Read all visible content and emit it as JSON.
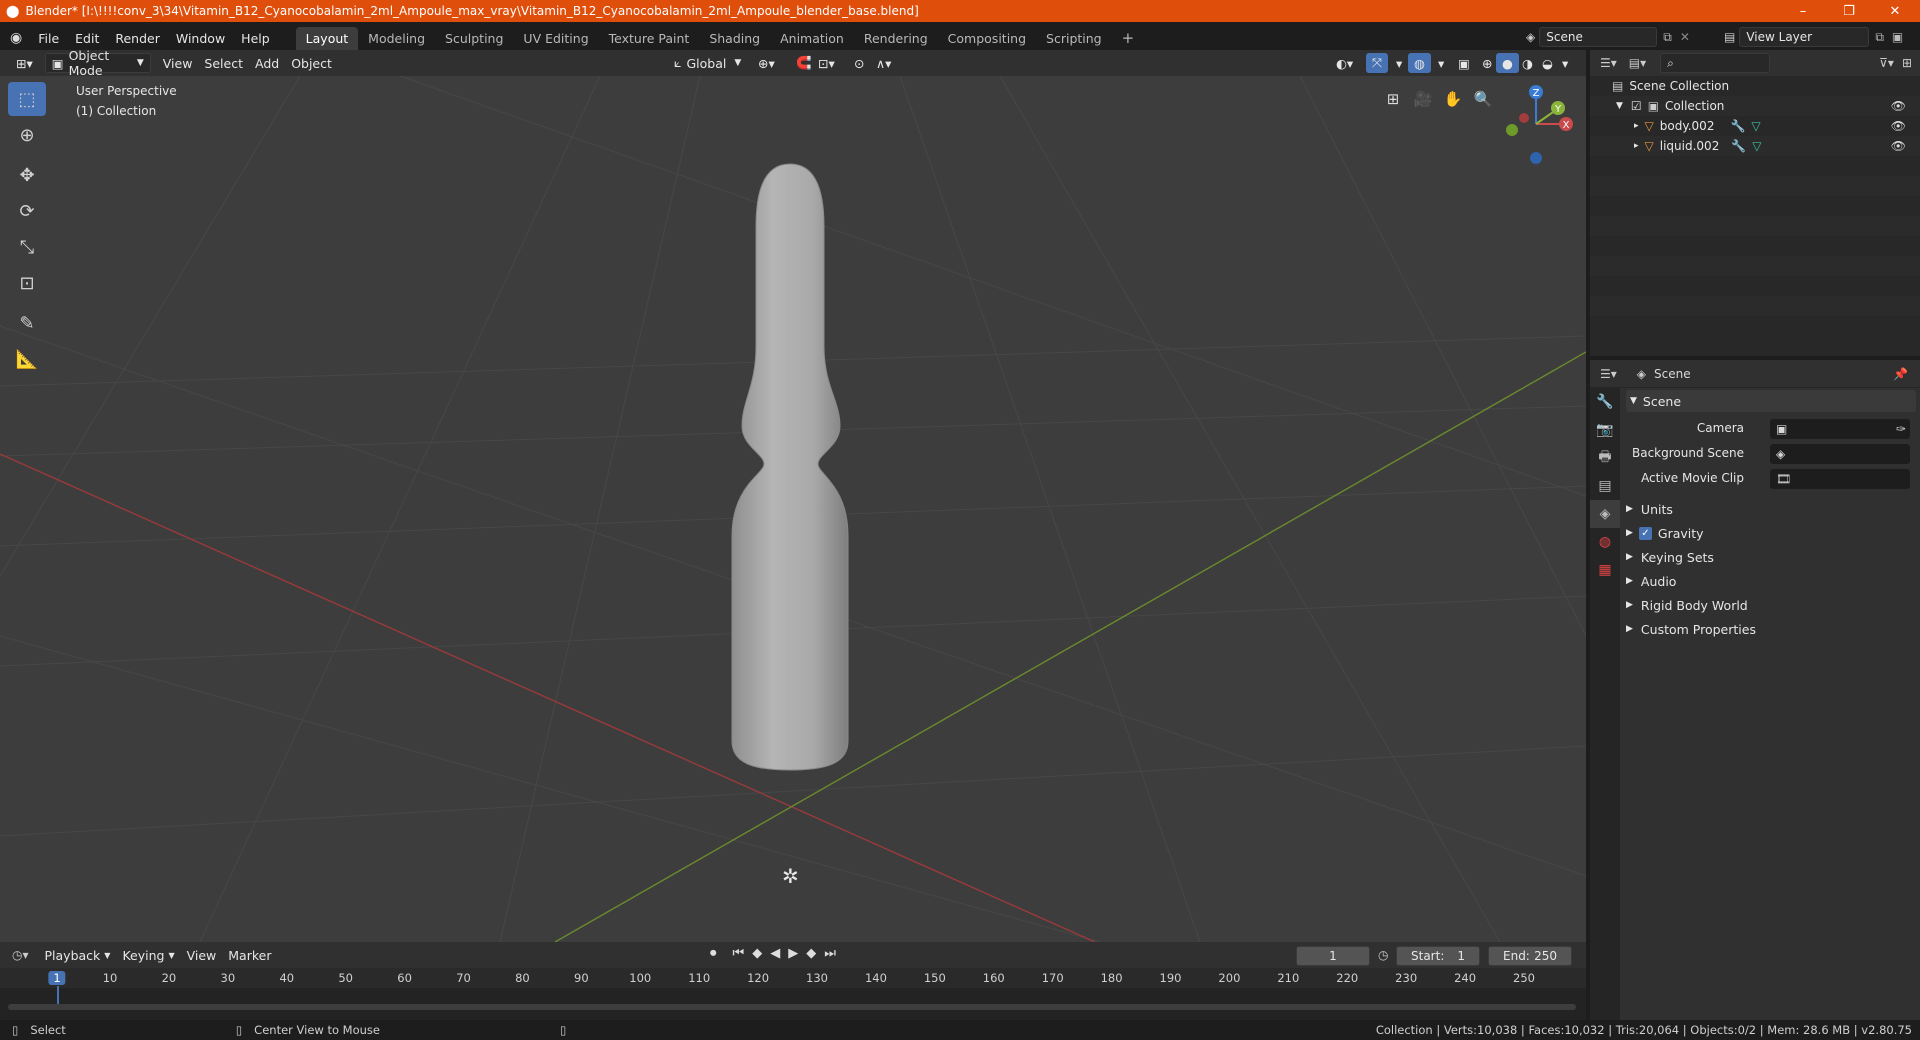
{
  "window": {
    "title": "Blender* [I:\\!!!!conv_3\\34\\Vitamin_B12_Cyanocobalamin_2ml_Ampoule_max_vray\\Vitamin_B12_Cyanocobalamin_2ml_Ampoule_blender_base.blend]",
    "minimize": "–",
    "maximize": "❐",
    "close": "✕"
  },
  "menu": [
    "File",
    "Edit",
    "Render",
    "Window",
    "Help"
  ],
  "workspaces": [
    "Layout",
    "Modeling",
    "Sculpting",
    "UV Editing",
    "Texture Paint",
    "Shading",
    "Animation",
    "Rendering",
    "Compositing",
    "Scripting"
  ],
  "active_workspace": "Layout",
  "scene_selector": "Scene",
  "view_layer": "View Layer",
  "viewport_header": {
    "mode": "Object Mode",
    "menus": [
      "View",
      "Select",
      "Add",
      "Object"
    ],
    "orientation": "Global"
  },
  "viewport": {
    "perspective": "User Perspective",
    "collection": "(1) Collection",
    "gizmo": {
      "z": "Z",
      "y": "Y",
      "x": "X"
    }
  },
  "outliner": {
    "root": "Scene Collection",
    "collection": "Collection",
    "items": [
      "body.002",
      "liquid.002"
    ]
  },
  "properties": {
    "context": "Scene",
    "panel": "Scene",
    "fields": [
      {
        "label": "Camera",
        "value": ""
      },
      {
        "label": "Background Scene",
        "value": ""
      },
      {
        "label": "Active Movie Clip",
        "value": ""
      }
    ],
    "sections": [
      "Units",
      "Gravity",
      "Keying Sets",
      "Audio",
      "Rigid Body World",
      "Custom Properties"
    ],
    "gravity_checked": true
  },
  "timeline": {
    "menus": [
      "Playback",
      "Keying",
      "View",
      "Marker"
    ],
    "current_frame": "1",
    "start_label": "Start:",
    "start": "1",
    "end_label": "End:",
    "end": "250",
    "ruler": [
      "1",
      "10",
      "20",
      "30",
      "40",
      "50",
      "60",
      "70",
      "80",
      "90",
      "100",
      "110",
      "120",
      "130",
      "140",
      "150",
      "160",
      "170",
      "180",
      "190",
      "200",
      "210",
      "220",
      "230",
      "240",
      "250"
    ]
  },
  "statusbar": {
    "left": "Select",
    "middle": "Center View to Mouse",
    "right": "Collection | Verts:10,038 | Faces:10,032 | Tris:20,064 | Objects:0/2 | Mem: 28.6 MB | v2.80.75"
  },
  "colors": {
    "titlebar": "#e04e0b",
    "accent": "#4772b3",
    "x_axis": "#c94b4b",
    "y_axis": "#8ab33a",
    "z_axis": "#3a7bd5"
  }
}
